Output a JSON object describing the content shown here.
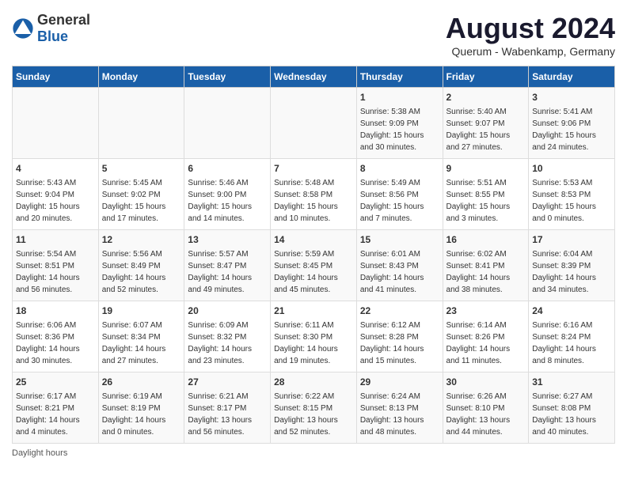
{
  "header": {
    "logo_general": "General",
    "logo_blue": "Blue",
    "month_year": "August 2024",
    "location": "Querum -  Wabenkamp, Germany"
  },
  "days_of_week": [
    "Sunday",
    "Monday",
    "Tuesday",
    "Wednesday",
    "Thursday",
    "Friday",
    "Saturday"
  ],
  "weeks": [
    [
      {
        "day": "",
        "info": ""
      },
      {
        "day": "",
        "info": ""
      },
      {
        "day": "",
        "info": ""
      },
      {
        "day": "",
        "info": ""
      },
      {
        "day": "1",
        "info": "Sunrise: 5:38 AM\nSunset: 9:09 PM\nDaylight: 15 hours\nand 30 minutes."
      },
      {
        "day": "2",
        "info": "Sunrise: 5:40 AM\nSunset: 9:07 PM\nDaylight: 15 hours\nand 27 minutes."
      },
      {
        "day": "3",
        "info": "Sunrise: 5:41 AM\nSunset: 9:06 PM\nDaylight: 15 hours\nand 24 minutes."
      }
    ],
    [
      {
        "day": "4",
        "info": "Sunrise: 5:43 AM\nSunset: 9:04 PM\nDaylight: 15 hours\nand 20 minutes."
      },
      {
        "day": "5",
        "info": "Sunrise: 5:45 AM\nSunset: 9:02 PM\nDaylight: 15 hours\nand 17 minutes."
      },
      {
        "day": "6",
        "info": "Sunrise: 5:46 AM\nSunset: 9:00 PM\nDaylight: 15 hours\nand 14 minutes."
      },
      {
        "day": "7",
        "info": "Sunrise: 5:48 AM\nSunset: 8:58 PM\nDaylight: 15 hours\nand 10 minutes."
      },
      {
        "day": "8",
        "info": "Sunrise: 5:49 AM\nSunset: 8:56 PM\nDaylight: 15 hours\nand 7 minutes."
      },
      {
        "day": "9",
        "info": "Sunrise: 5:51 AM\nSunset: 8:55 PM\nDaylight: 15 hours\nand 3 minutes."
      },
      {
        "day": "10",
        "info": "Sunrise: 5:53 AM\nSunset: 8:53 PM\nDaylight: 15 hours\nand 0 minutes."
      }
    ],
    [
      {
        "day": "11",
        "info": "Sunrise: 5:54 AM\nSunset: 8:51 PM\nDaylight: 14 hours\nand 56 minutes."
      },
      {
        "day": "12",
        "info": "Sunrise: 5:56 AM\nSunset: 8:49 PM\nDaylight: 14 hours\nand 52 minutes."
      },
      {
        "day": "13",
        "info": "Sunrise: 5:57 AM\nSunset: 8:47 PM\nDaylight: 14 hours\nand 49 minutes."
      },
      {
        "day": "14",
        "info": "Sunrise: 5:59 AM\nSunset: 8:45 PM\nDaylight: 14 hours\nand 45 minutes."
      },
      {
        "day": "15",
        "info": "Sunrise: 6:01 AM\nSunset: 8:43 PM\nDaylight: 14 hours\nand 41 minutes."
      },
      {
        "day": "16",
        "info": "Sunrise: 6:02 AM\nSunset: 8:41 PM\nDaylight: 14 hours\nand 38 minutes."
      },
      {
        "day": "17",
        "info": "Sunrise: 6:04 AM\nSunset: 8:39 PM\nDaylight: 14 hours\nand 34 minutes."
      }
    ],
    [
      {
        "day": "18",
        "info": "Sunrise: 6:06 AM\nSunset: 8:36 PM\nDaylight: 14 hours\nand 30 minutes."
      },
      {
        "day": "19",
        "info": "Sunrise: 6:07 AM\nSunset: 8:34 PM\nDaylight: 14 hours\nand 27 minutes."
      },
      {
        "day": "20",
        "info": "Sunrise: 6:09 AM\nSunset: 8:32 PM\nDaylight: 14 hours\nand 23 minutes."
      },
      {
        "day": "21",
        "info": "Sunrise: 6:11 AM\nSunset: 8:30 PM\nDaylight: 14 hours\nand 19 minutes."
      },
      {
        "day": "22",
        "info": "Sunrise: 6:12 AM\nSunset: 8:28 PM\nDaylight: 14 hours\nand 15 minutes."
      },
      {
        "day": "23",
        "info": "Sunrise: 6:14 AM\nSunset: 8:26 PM\nDaylight: 14 hours\nand 11 minutes."
      },
      {
        "day": "24",
        "info": "Sunrise: 6:16 AM\nSunset: 8:24 PM\nDaylight: 14 hours\nand 8 minutes."
      }
    ],
    [
      {
        "day": "25",
        "info": "Sunrise: 6:17 AM\nSunset: 8:21 PM\nDaylight: 14 hours\nand 4 minutes."
      },
      {
        "day": "26",
        "info": "Sunrise: 6:19 AM\nSunset: 8:19 PM\nDaylight: 14 hours\nand 0 minutes."
      },
      {
        "day": "27",
        "info": "Sunrise: 6:21 AM\nSunset: 8:17 PM\nDaylight: 13 hours\nand 56 minutes."
      },
      {
        "day": "28",
        "info": "Sunrise: 6:22 AM\nSunset: 8:15 PM\nDaylight: 13 hours\nand 52 minutes."
      },
      {
        "day": "29",
        "info": "Sunrise: 6:24 AM\nSunset: 8:13 PM\nDaylight: 13 hours\nand 48 minutes."
      },
      {
        "day": "30",
        "info": "Sunrise: 6:26 AM\nSunset: 8:10 PM\nDaylight: 13 hours\nand 44 minutes."
      },
      {
        "day": "31",
        "info": "Sunrise: 6:27 AM\nSunset: 8:08 PM\nDaylight: 13 hours\nand 40 minutes."
      }
    ]
  ],
  "footer": {
    "daylight_hours_label": "Daylight hours"
  }
}
